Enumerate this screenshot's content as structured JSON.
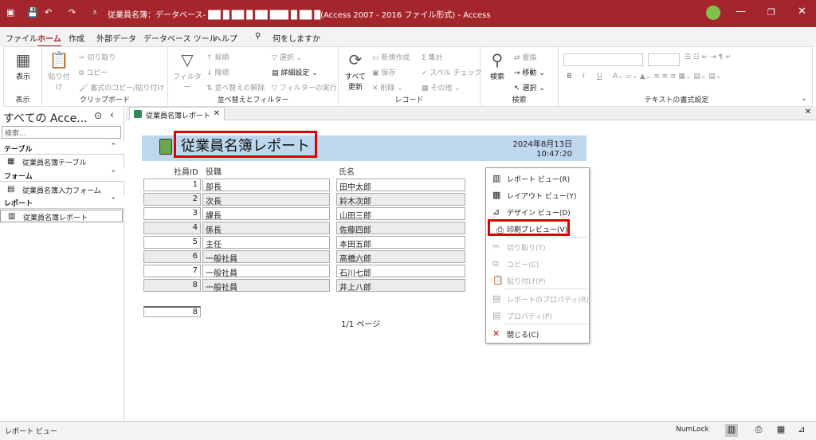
{
  "title_bar": {
    "title": "従業員名簿：データベース- ██ █ ██ █ ██  ███ █ ██ █(Access 2007 - 2016 ファイル形式)  -  Access",
    "minimize": "—",
    "restore": "❐",
    "close": "✕"
  },
  "menu": {
    "tabs": [
      "ファイル",
      "ホーム",
      "作成",
      "外部データ",
      "データベース ツール",
      "ヘルプ"
    ],
    "active_tab": "ホーム",
    "search": "何をしますか"
  },
  "ribbon": {
    "groups": {
      "view": {
        "label": "表示",
        "button": "表示"
      },
      "clipboard": {
        "label": "クリップボード",
        "paste": "貼り付け",
        "cut": "切り取り",
        "copy": "コピー",
        "format_painter": "書式のコピー/貼り付け"
      },
      "sort_filter": {
        "label": "並べ替えとフィルター",
        "filter": "フィルター",
        "ascending": "昇順",
        "descending": "降順",
        "clear_sort": "並べ替えの解除",
        "selection": "選択",
        "advanced": "詳細設定",
        "toggle_filter": "フィルターの実行"
      },
      "records": {
        "label": "レコード",
        "refresh_all": "すべて更新",
        "new": "新規作成",
        "save": "保存",
        "delete": "削除",
        "totals": "集計",
        "spelling": "スペル チェック",
        "more": "その他"
      },
      "find": {
        "label": "検索",
        "find": "検索",
        "replace": "置換",
        "goto": "移動",
        "select": "選択"
      },
      "text_format": {
        "label": "テキストの書式設定"
      }
    }
  },
  "nav_pane": {
    "header": "すべての Acce...",
    "search_placeholder": "検索...",
    "sections": [
      {
        "label": "テーブル",
        "items": [
          "従業員名簿テーブル"
        ]
      },
      {
        "label": "フォーム",
        "items": [
          "従業員名簿入力フォーム"
        ]
      },
      {
        "label": "レポート",
        "items": [
          "従業員名簿レポート"
        ]
      }
    ]
  },
  "document_tab": {
    "label": "従業員名簿レポート"
  },
  "report": {
    "title": "従業員名簿レポート",
    "date": "2024年8月13日",
    "time": "10:47:20",
    "columns": [
      "社員ID",
      "役職",
      "氏名"
    ],
    "rows": [
      {
        "id": "1",
        "position": "部長",
        "name": "田中太郎"
      },
      {
        "id": "2",
        "position": "次長",
        "name": "鈴木次郎"
      },
      {
        "id": "3",
        "position": "課長",
        "name": "山田三郎"
      },
      {
        "id": "4",
        "position": "係長",
        "name": "佐藤四郎"
      },
      {
        "id": "5",
        "position": "主任",
        "name": "本田五郎"
      },
      {
        "id": "6",
        "position": "一般社員",
        "name": "高橋六郎"
      },
      {
        "id": "7",
        "position": "一般社員",
        "name": "石川七郎"
      },
      {
        "id": "8",
        "position": "一般社員",
        "name": "井上八郎"
      }
    ],
    "total": "8",
    "pager": "1/1 ページ"
  },
  "context_menu": [
    {
      "label": "レポート ビュー(R)",
      "icon": "report-view-icon",
      "enabled": true
    },
    {
      "label": "レイアウト ビュー(Y)",
      "icon": "layout-view-icon",
      "enabled": true
    },
    {
      "label": "デザイン ビュー(D)",
      "icon": "design-view-icon",
      "enabled": true
    },
    {
      "label": "印刷プレビュー(V)",
      "icon": "print-preview-icon",
      "enabled": true
    },
    {
      "label": "切り取り(T)",
      "icon": "scissors-icon",
      "enabled": false
    },
    {
      "label": "コピー(C)",
      "icon": "copy-icon",
      "enabled": false
    },
    {
      "label": "貼り付け(P)",
      "icon": "paste-icon",
      "enabled": false
    },
    {
      "label": "レポートのプロパティ(R)",
      "icon": "report-properties-icon",
      "enabled": false
    },
    {
      "label": "プロパティ(P)",
      "icon": "properties-icon",
      "enabled": false
    },
    {
      "label": "閉じる(C)",
      "icon": "close-doc-icon",
      "enabled": true
    }
  ],
  "status_bar": {
    "left": "レポート ビュー",
    "numlock": "NumLock"
  },
  "colors": {
    "accent": "#a4262c",
    "band": "#bdd7ee",
    "highlight": "#e00000"
  }
}
